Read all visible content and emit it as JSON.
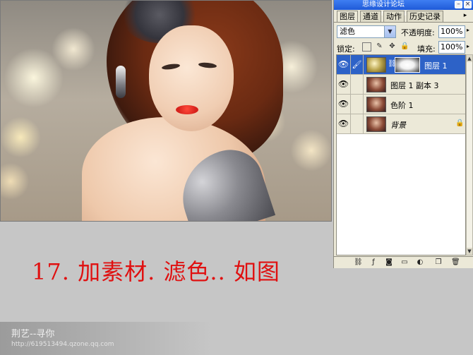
{
  "caption": "17. 加素材. 滤色.. 如图",
  "watermark": {
    "name": "荆艺--寻你",
    "url": "http://619513494.qzone.qq.com"
  },
  "panel": {
    "title": "思缘设计论坛 www.missyuan.com",
    "tabs": [
      "图层",
      "通道",
      "动作",
      "历史记录"
    ],
    "active_tab": "图层",
    "blend_mode": "滤色",
    "opacity_label": "不透明度:",
    "opacity_value": "100%",
    "lock_label": "锁定:",
    "fill_label": "填充:",
    "fill_value": "100%",
    "layers": [
      {
        "name": "图层 1",
        "selected": true,
        "thumbnail": "bokeh",
        "has_mask": true,
        "visible": true
      },
      {
        "name": "图层 1 副本 3",
        "selected": false,
        "thumbnail": "photo",
        "has_mask": false,
        "visible": true
      },
      {
        "name": "色阶 1",
        "selected": false,
        "thumbnail": "photo",
        "has_mask": false,
        "visible": true
      },
      {
        "name": "背景",
        "selected": false,
        "thumbnail": "photo",
        "has_mask": false,
        "visible": true,
        "locked": true
      }
    ]
  },
  "colors": {
    "caption": "#e01010",
    "selected_layer": "#2d62c7",
    "titlebar": "#1f5ad8",
    "panel_bg": "#ece9d8"
  },
  "icons": {
    "titlebar": [
      "minimize-icon",
      "close-icon"
    ],
    "layer_row": [
      "eye-icon",
      "brush-icon",
      "chain-link-icon",
      "lock-icon"
    ],
    "lock_row": [
      "lock-transparent-icon",
      "lock-paint-icon",
      "lock-move-icon",
      "lock-all-icon"
    ],
    "bottom_bar": [
      "link-layers-icon",
      "layer-style-icon",
      "add-mask-icon",
      "new-group-icon",
      "adjustment-layer-icon",
      "new-layer-icon",
      "trash-icon"
    ]
  }
}
